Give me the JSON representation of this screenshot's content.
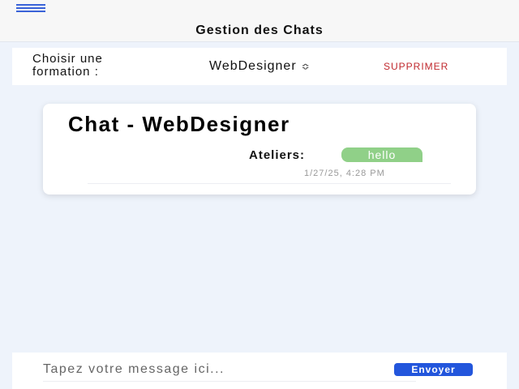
{
  "header": {
    "title": "Gestion des Chats",
    "menu_icon": "hamburger-icon"
  },
  "formation": {
    "label_line1": "Choisir une",
    "label_line2": "formation :",
    "selected": "WebDesigner",
    "chevron": "≎",
    "delete_label": "SUPPRIMER"
  },
  "chat": {
    "title": "Chat - WebDesigner",
    "messages": [
      {
        "sender": "Ateliers:",
        "text": "hello",
        "timestamp": "1/27/25, 4:28 PM"
      }
    ]
  },
  "composer": {
    "placeholder": "Tapez votre message ici...",
    "send_label": "Envoyer"
  },
  "colors": {
    "accent": "#2356dc",
    "bubble": "#90d088",
    "danger": "#c0282d"
  }
}
